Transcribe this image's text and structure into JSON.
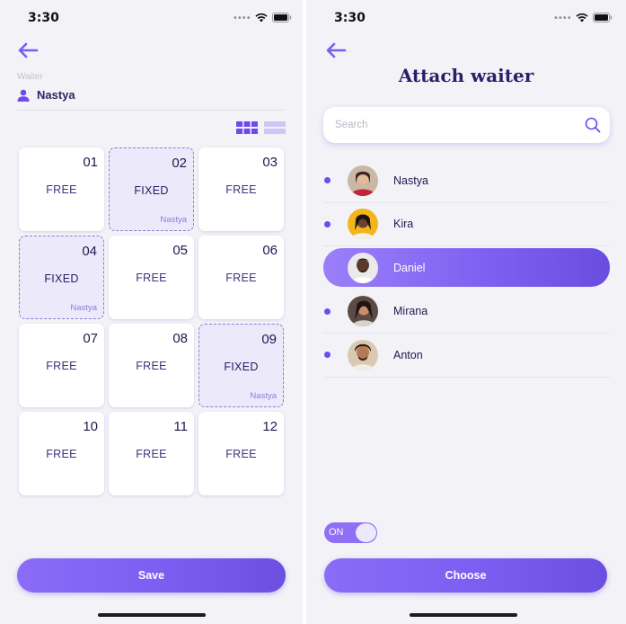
{
  "left": {
    "status_time": "3:30",
    "waiter_label": "Waiter",
    "waiter_name": "Nastya",
    "tables": [
      {
        "number": "01",
        "status": "FREE",
        "assignee": ""
      },
      {
        "number": "02",
        "status": "FIXED",
        "assignee": "Nastya"
      },
      {
        "number": "03",
        "status": "FREE",
        "assignee": ""
      },
      {
        "number": "04",
        "status": "FIXED",
        "assignee": "Nastya"
      },
      {
        "number": "05",
        "status": "FREE",
        "assignee": ""
      },
      {
        "number": "06",
        "status": "FREE",
        "assignee": ""
      },
      {
        "number": "07",
        "status": "FREE",
        "assignee": ""
      },
      {
        "number": "08",
        "status": "FREE",
        "assignee": ""
      },
      {
        "number": "09",
        "status": "FIXED",
        "assignee": "Nastya"
      },
      {
        "number": "10",
        "status": "FREE",
        "assignee": ""
      },
      {
        "number": "11",
        "status": "FREE",
        "assignee": ""
      },
      {
        "number": "12",
        "status": "FREE",
        "assignee": ""
      }
    ],
    "save_label": "Save"
  },
  "right": {
    "status_time": "3:30",
    "title": "Attach waiter",
    "search_placeholder": "Search",
    "waiters": [
      {
        "name": "Nastya",
        "selected": false
      },
      {
        "name": "Kira",
        "selected": false
      },
      {
        "name": "Daniel",
        "selected": true
      },
      {
        "name": "Mirana",
        "selected": false
      },
      {
        "name": "Anton",
        "selected": false
      }
    ],
    "toggle_label": "ON",
    "choose_label": "Choose"
  },
  "colors": {
    "accent": "#7b5cf0",
    "accent_dark": "#2a1f6b",
    "fixed_bg": "#ece9fb",
    "background": "#f2f2f7"
  },
  "icons": {
    "back": "arrow-left-icon",
    "user": "person-icon",
    "grid_view": "grid-view-icon",
    "list_view": "list-view-icon",
    "search": "search-icon",
    "signal": "signal-dots-icon",
    "wifi": "wifi-icon",
    "battery": "battery-icon"
  }
}
